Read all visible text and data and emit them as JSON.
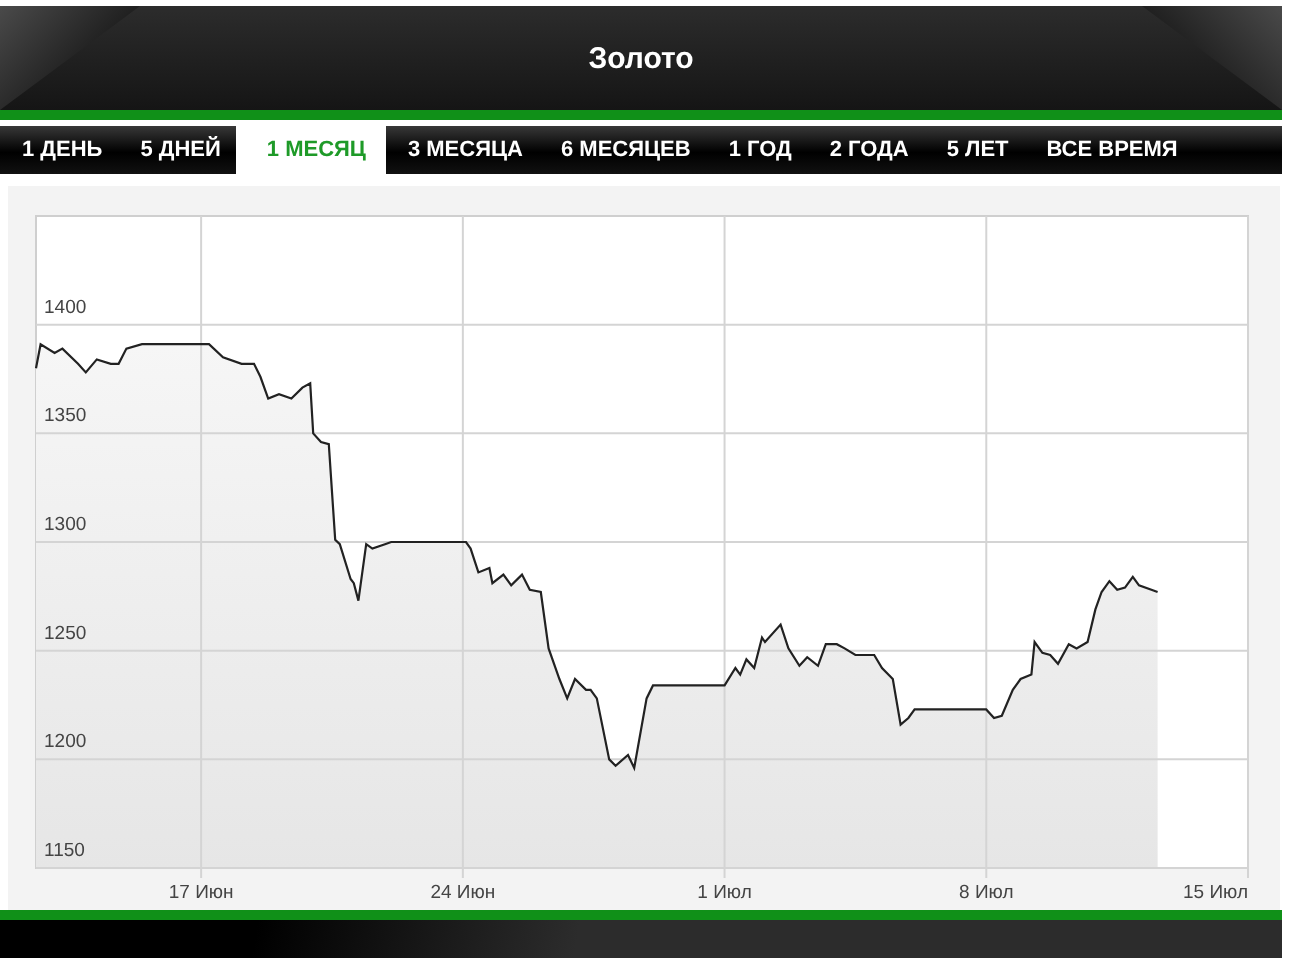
{
  "window": {
    "title": "Золото"
  },
  "tabs": [
    {
      "label": "1 ДЕНЬ",
      "selected": false
    },
    {
      "label": "5 ДНЕЙ",
      "selected": false
    },
    {
      "label": "1 МЕСЯЦ",
      "selected": true
    },
    {
      "label": "3 МЕСЯЦА",
      "selected": false
    },
    {
      "label": "6 МЕСЯЦЕВ",
      "selected": false
    },
    {
      "label": "1 ГОД",
      "selected": false
    },
    {
      "label": "2 ГОДА",
      "selected": false
    },
    {
      "label": "5 ЛЕТ",
      "selected": false
    },
    {
      "label": "ВСЕ ВРЕМЯ",
      "selected": false
    }
  ],
  "chart": {
    "chart_data": {
      "type": "area",
      "grid": true,
      "x": [
        "--06-12T14:00",
        "--06-12T17:00",
        "--06-13T02:00",
        "--06-13T07:00",
        "--06-13T17:00",
        "--06-13T22:00",
        "--06-14T05:00",
        "--06-14T14:00",
        "--06-14T19:00",
        "--06-15T00:00",
        "--06-15T10:00",
        "--06-17T05:00",
        "--06-17T14:00",
        "--06-18T02:00",
        "--06-18T10:00",
        "--06-18T14:00",
        "--06-18T19:00",
        "--06-19T02:00",
        "--06-19T10:00",
        "--06-19T17:00",
        "--06-19T22:00",
        "--06-20T00:00",
        "--06-20T05:00",
        "--06-20T10:00",
        "--06-20T14:00",
        "--06-20T17:00",
        "--06-21T00:00",
        "--06-21T02:00",
        "--06-21T05:00",
        "--06-21T10:00",
        "--06-21T14:00",
        "--06-21T22:00",
        "--06-22T02:00",
        "--06-24T02:00",
        "--06-24T05:00",
        "--06-24T10:00",
        "--06-24T17:00",
        "--06-24T19:00",
        "--06-25T02:00",
        "--06-25T07:00",
        "--06-25T14:00",
        "--06-25T19:00",
        "--06-26T02:00",
        "--06-26T07:00",
        "--06-26T14:00",
        "--06-26T19:00",
        "--06-27T00:00",
        "--06-27T07:00",
        "--06-27T10:00",
        "--06-27T14:00",
        "--06-27T22:00",
        "--06-28T02:00",
        "--06-28T10:00",
        "--06-28T14:00",
        "--06-28T22:00",
        "--06-29T02:00",
        "--06-29T10:00",
        "--07-01T00:00",
        "--07-01T07:00",
        "--07-01T10:00",
        "--07-01T14:00",
        "--07-01T19:00",
        "--07-02T00:00",
        "--07-02T02:00",
        "--07-02T12:00",
        "--07-02T17:00",
        "--07-03T00:00",
        "--07-03T05:00",
        "--07-03T12:00",
        "--07-03T17:00",
        "--07-04T00:00",
        "--07-04T05:00",
        "--07-04T12:00",
        "--07-05T00:00",
        "--07-05T05:00",
        "--07-05T12:00",
        "--07-05T17:00",
        "--07-05T22:00",
        "--07-06T02:00",
        "--07-08T00:00",
        "--07-08T05:00",
        "--07-08T10:00",
        "--07-08T17:00",
        "--07-08T22:00",
        "--07-09T05:00",
        "--07-09T07:00",
        "--07-09T12:00",
        "--07-09T17:00",
        "--07-09T22:00",
        "--07-10T05:00",
        "--07-10T10:00",
        "--07-10T17:00",
        "--07-10T22:00",
        "--07-11T02:00",
        "--07-11T07:00",
        "--07-11T12:00",
        "--07-11T17:00",
        "--07-11T22:00",
        "--07-12T02:00",
        "--07-12T10:00",
        "--07-12T14:00"
      ],
      "series": [
        {
          "color": "#222222",
          "values": [
            1380,
            1391,
            1387,
            1389,
            1382,
            1378,
            1384,
            1382,
            1382,
            1389,
            1391,
            1391,
            1385,
            1382,
            1382,
            1376,
            1366,
            1368,
            1366,
            1371,
            1373,
            1350,
            1346,
            1345,
            1301,
            1299,
            1283,
            1281,
            1273,
            1299,
            1297,
            1299,
            1300,
            1300,
            1297,
            1286,
            1288,
            1281,
            1285,
            1280,
            1285,
            1278,
            1277,
            1251,
            1237,
            1228,
            1237,
            1232,
            1232,
            1228,
            1200,
            1197,
            1202,
            1196,
            1228,
            1234,
            1234,
            1234,
            1242,
            1239,
            1246,
            1242,
            1256,
            1254,
            1262,
            1251,
            1243,
            1247,
            1243,
            1253,
            1253,
            1251,
            1248,
            1248,
            1242,
            1237,
            1216,
            1219,
            1223,
            1223,
            1219,
            1220,
            1232,
            1237,
            1239,
            1254,
            1249,
            1248,
            1244,
            1253,
            1251,
            1254,
            1269,
            1277,
            1282,
            1278,
            1279,
            1284,
            1280,
            1278,
            1277
          ]
        }
      ],
      "xlim": [
        "--06-12T14:00",
        "--07-15T00:00"
      ],
      "ylim": [
        1150,
        1450
      ],
      "xticks": [
        {
          "value": "--06-17",
          "label": "17 Июн"
        },
        {
          "value": "--06-24",
          "label": "24 Июн"
        },
        {
          "value": "--07-01",
          "label": "1 Июл"
        },
        {
          "value": "--07-08",
          "label": "8 Июл"
        },
        {
          "value": "--07-15",
          "label": "15 Июл"
        }
      ],
      "yticks": [
        1150,
        1200,
        1250,
        1300,
        1350,
        1400
      ]
    }
  }
}
